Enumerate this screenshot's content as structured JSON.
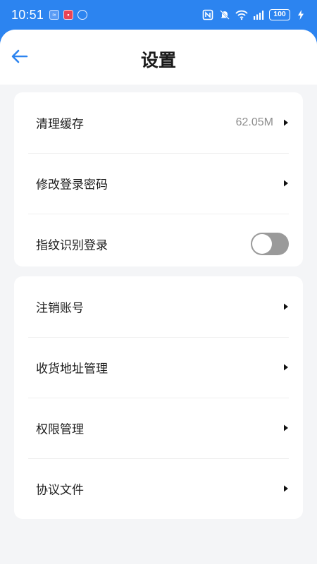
{
  "status_bar": {
    "time": "10:51",
    "battery": "100"
  },
  "header": {
    "title": "设置"
  },
  "group1": {
    "items": [
      {
        "label": "清理缓存",
        "value": "62.05M"
      },
      {
        "label": "修改登录密码"
      },
      {
        "label": "指纹识别登录",
        "toggle_on": false
      }
    ]
  },
  "group2": {
    "items": [
      {
        "label": "注销账号"
      },
      {
        "label": "收货地址管理"
      },
      {
        "label": "权限管理"
      },
      {
        "label": "协议文件"
      }
    ]
  },
  "colors": {
    "accent": "#2c84f0",
    "background": "#f4f5f7",
    "toggle_off": "#9a9a9a"
  }
}
